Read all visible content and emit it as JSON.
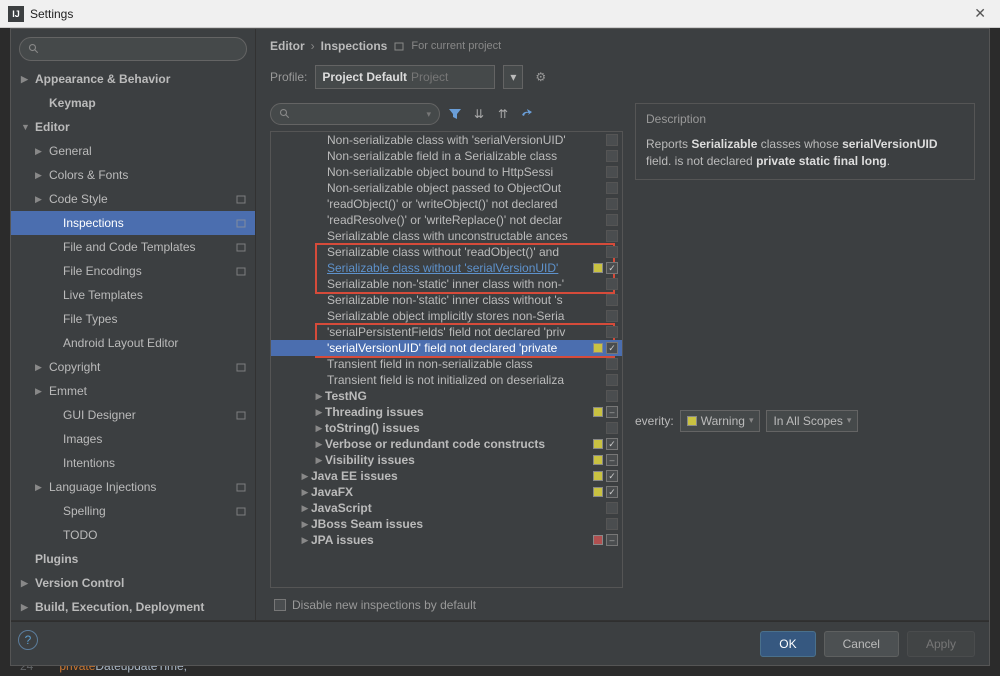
{
  "window": {
    "title": "Settings"
  },
  "breadcrumb": {
    "a": "Editor",
    "b": "Inspections",
    "note": "For current project"
  },
  "profile": {
    "label": "Profile:",
    "name": "Project Default",
    "suffix": "Project"
  },
  "nav": [
    {
      "lvl": 1,
      "label": "Appearance & Behavior",
      "arrow": "▶",
      "bold": true
    },
    {
      "lvl": 2,
      "label": "Keymap",
      "arrow": "",
      "bold": true
    },
    {
      "lvl": 1,
      "label": "Editor",
      "arrow": "▼",
      "bold": true
    },
    {
      "lvl": 2,
      "label": "General",
      "arrow": "▶",
      "bold": false
    },
    {
      "lvl": 2,
      "label": "Colors & Fonts",
      "arrow": "▶",
      "bold": false
    },
    {
      "lvl": 2,
      "label": "Code Style",
      "arrow": "▶",
      "bold": false,
      "proj": true
    },
    {
      "lvl": 3,
      "label": "Inspections",
      "arrow": "",
      "bold": false,
      "sel": true,
      "proj": true
    },
    {
      "lvl": 3,
      "label": "File and Code Templates",
      "arrow": "",
      "bold": false,
      "proj": true
    },
    {
      "lvl": 3,
      "label": "File Encodings",
      "arrow": "",
      "bold": false,
      "proj": true
    },
    {
      "lvl": 3,
      "label": "Live Templates",
      "arrow": "",
      "bold": false
    },
    {
      "lvl": 3,
      "label": "File Types",
      "arrow": "",
      "bold": false
    },
    {
      "lvl": 3,
      "label": "Android Layout Editor",
      "arrow": "",
      "bold": false
    },
    {
      "lvl": 2,
      "label": "Copyright",
      "arrow": "▶",
      "bold": false,
      "proj": true
    },
    {
      "lvl": 2,
      "label": "Emmet",
      "arrow": "▶",
      "bold": false
    },
    {
      "lvl": 3,
      "label": "GUI Designer",
      "arrow": "",
      "bold": false,
      "proj": true
    },
    {
      "lvl": 3,
      "label": "Images",
      "arrow": "",
      "bold": false
    },
    {
      "lvl": 3,
      "label": "Intentions",
      "arrow": "",
      "bold": false
    },
    {
      "lvl": 2,
      "label": "Language Injections",
      "arrow": "▶",
      "bold": false,
      "proj": true
    },
    {
      "lvl": 3,
      "label": "Spelling",
      "arrow": "",
      "bold": false,
      "proj": true
    },
    {
      "lvl": 3,
      "label": "TODO",
      "arrow": "",
      "bold": false
    },
    {
      "lvl": 1,
      "label": "Plugins",
      "arrow": "",
      "bold": true
    },
    {
      "lvl": 1,
      "label": "Version Control",
      "arrow": "▶",
      "bold": true
    },
    {
      "lvl": 1,
      "label": "Build, Execution, Deployment",
      "arrow": "▶",
      "bold": true
    }
  ],
  "tree": [
    {
      "ind": 56,
      "txt": "Non-serializable class with 'serialVersionUID'",
      "st": "g"
    },
    {
      "ind": 56,
      "txt": "Non-serializable field in a Serializable class",
      "st": "g"
    },
    {
      "ind": 56,
      "txt": "Non-serializable object bound to HttpSessi",
      "st": "g"
    },
    {
      "ind": 56,
      "txt": "Non-serializable object passed to ObjectOut",
      "st": "g"
    },
    {
      "ind": 56,
      "txt": "'readObject()' or 'writeObject()' not declared",
      "st": "g"
    },
    {
      "ind": 56,
      "txt": "'readResolve()' or 'writeReplace()' not declar",
      "st": "g"
    },
    {
      "ind": 56,
      "txt": "Serializable class with unconstructable ances",
      "st": "g"
    },
    {
      "ind": 56,
      "txt": "Serializable class without 'readObject()' and",
      "st": "g"
    },
    {
      "ind": 56,
      "txt": "Serializable class without 'serialVersionUID'",
      "st": "yc",
      "link": true
    },
    {
      "ind": 56,
      "txt": "Serializable non-'static' inner class with non-'",
      "st": "g"
    },
    {
      "ind": 56,
      "txt": "Serializable non-'static' inner class without 's",
      "st": "g"
    },
    {
      "ind": 56,
      "txt": "Serializable object implicitly stores non-Seria",
      "st": "g"
    },
    {
      "ind": 56,
      "txt": "'serialPersistentFields' field not declared 'priv",
      "st": "g"
    },
    {
      "ind": 56,
      "txt": "'serialVersionUID' field not declared 'private",
      "st": "yc",
      "sel": true
    },
    {
      "ind": 56,
      "txt": "Transient field in non-serializable class",
      "st": "g"
    },
    {
      "ind": 56,
      "txt": "Transient field is not initialized on deserializa",
      "st": "g"
    },
    {
      "ind": 42,
      "arrow": "▶",
      "txt": "TestNG",
      "st": "g",
      "bold": true
    },
    {
      "ind": 42,
      "arrow": "▶",
      "txt": "Threading issues",
      "st": "ym",
      "bold": true
    },
    {
      "ind": 42,
      "arrow": "▶",
      "txt": "toString() issues",
      "st": "g",
      "bold": true
    },
    {
      "ind": 42,
      "arrow": "▶",
      "txt": "Verbose or redundant code constructs",
      "st": "yc",
      "bold": true
    },
    {
      "ind": 42,
      "arrow": "▶",
      "txt": "Visibility issues",
      "st": "ym",
      "bold": true
    },
    {
      "ind": 28,
      "arrow": "▶",
      "txt": "Java EE issues",
      "st": "yc",
      "bold": true
    },
    {
      "ind": 28,
      "arrow": "▶",
      "txt": "JavaFX",
      "st": "yc",
      "bold": true
    },
    {
      "ind": 28,
      "arrow": "▶",
      "txt": "JavaScript",
      "st": "g",
      "bold": true
    },
    {
      "ind": 28,
      "arrow": "▶",
      "txt": "JBoss Seam issues",
      "st": "g",
      "bold": true
    },
    {
      "ind": 28,
      "arrow": "▶",
      "txt": "JPA issues",
      "st": "rm",
      "bold": true
    }
  ],
  "disable_label": "Disable new inspections by default",
  "desc": {
    "header": "Description",
    "pre": "Reports ",
    "b1": "Serializable",
    "mid1": " classes whose ",
    "b2": "serialVersionUID",
    "mid2": " field. is not declared ",
    "b3": "private static final long",
    "post": "."
  },
  "severity": {
    "label": "everity:",
    "value": "Warning",
    "scope": "In All Scopes"
  },
  "buttons": {
    "ok": "OK",
    "cancel": "Cancel",
    "apply": "Apply"
  },
  "editor_line": {
    "num": "24",
    "kw": "private",
    "type": " Date ",
    "var": "updateTime;"
  }
}
